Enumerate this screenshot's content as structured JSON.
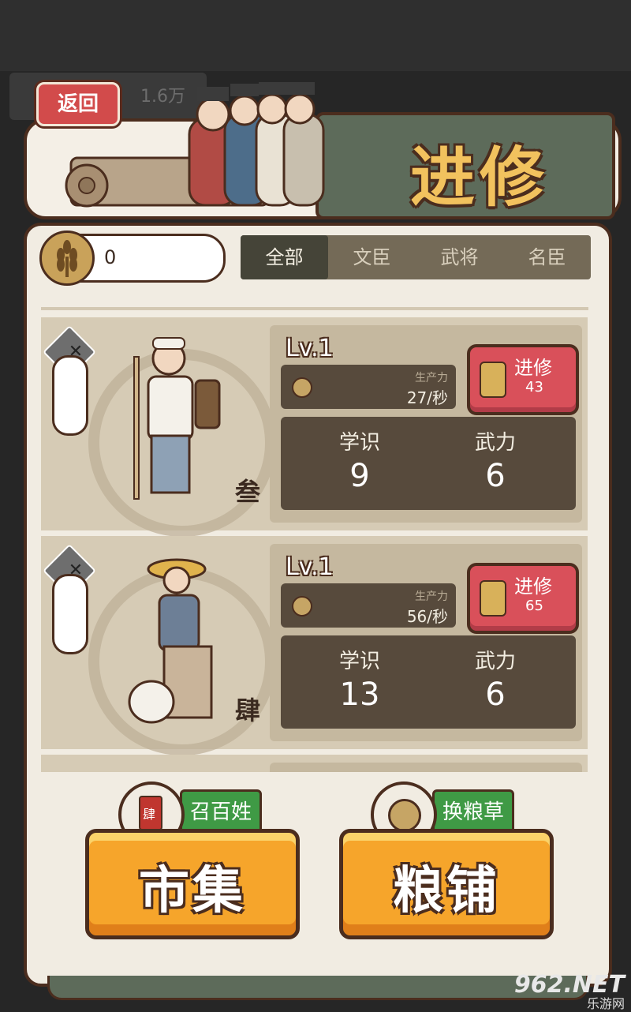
{
  "header": {
    "back_label": "返回",
    "title": "进修",
    "bg_resource": "1.6万"
  },
  "resource": {
    "icon": "wheat-icon",
    "value": "0"
  },
  "tabs": [
    {
      "label": "全部",
      "active": true
    },
    {
      "label": "文臣",
      "active": false
    },
    {
      "label": "武将",
      "active": false
    },
    {
      "label": "名臣",
      "active": false
    }
  ],
  "cards": [
    {
      "name_label": "叁",
      "level": "Lv.1",
      "production_label": "生产力",
      "production_value": "27/秒",
      "train_label": "进修",
      "train_cost": "43",
      "stat1_label": "学识",
      "stat1_value": "9",
      "stat2_label": "武力",
      "stat2_value": "6"
    },
    {
      "name_label": "肆",
      "level": "Lv.1",
      "production_label": "生产力",
      "production_value": "56/秒",
      "train_label": "进修",
      "train_cost": "65",
      "stat1_label": "学识",
      "stat1_value": "13",
      "stat2_label": "武力",
      "stat2_value": "6"
    }
  ],
  "buttons": {
    "market_tag": "召百姓",
    "market_label": "市集",
    "grain_tag": "换粮草",
    "grain_label": "粮铺",
    "seal_text": "肆"
  },
  "watermark": {
    "text": "962.NET",
    "sub": "乐游网"
  },
  "colors": {
    "panel": "#f1ece2",
    "border": "#4b2d1e",
    "accent_red": "#d9505a",
    "button_orange": "#f6a52b",
    "tag_green": "#3f9a45"
  }
}
